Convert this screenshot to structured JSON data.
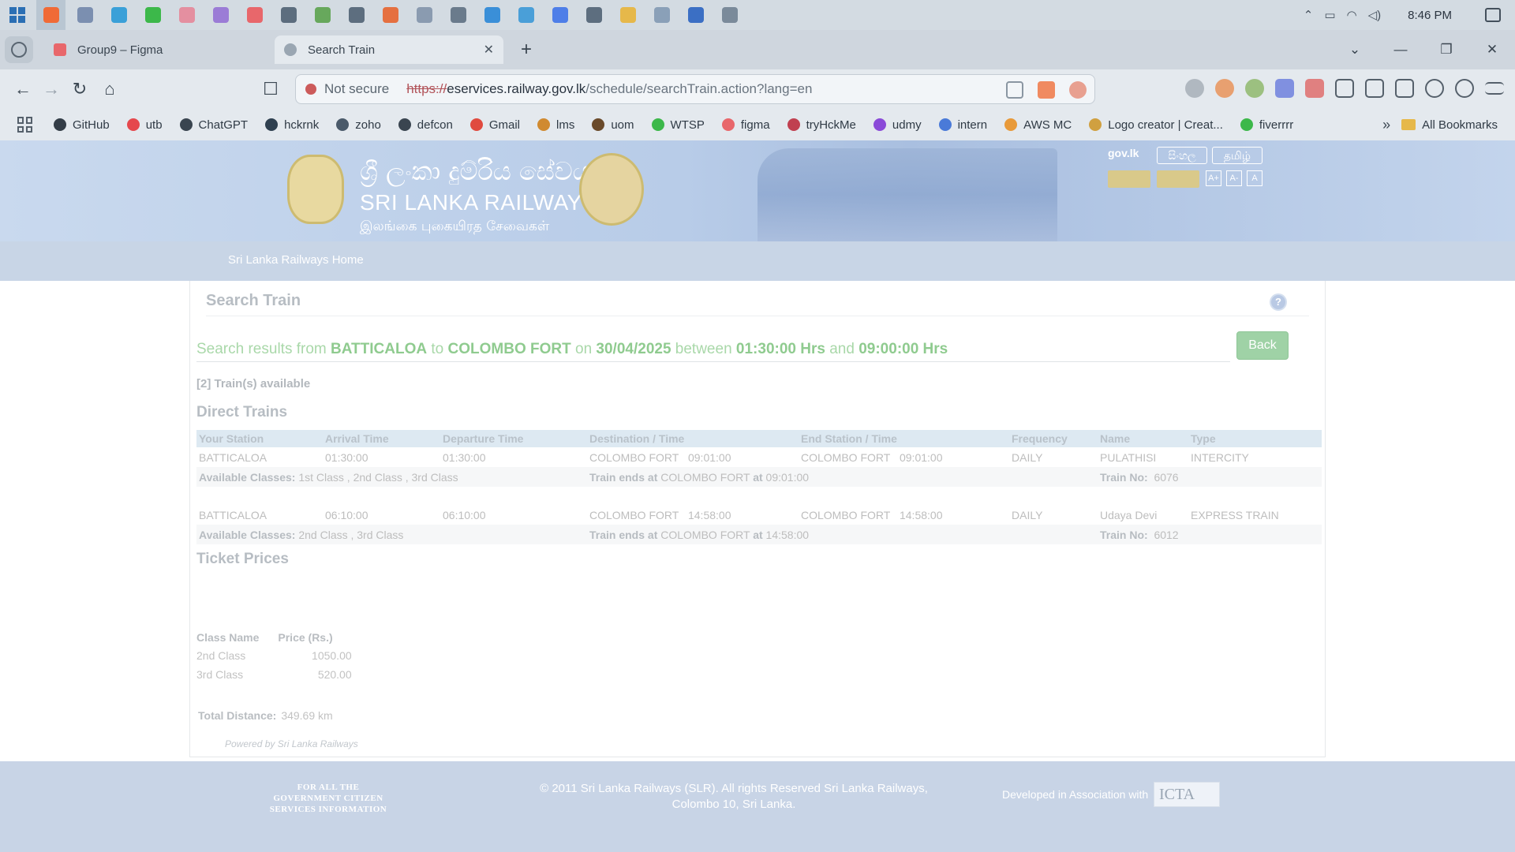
{
  "taskbar": {
    "clock": "8:46 PM",
    "apps": [
      {
        "icon": "brave-icon",
        "color": "#f06a36"
      },
      {
        "icon": "app-icon",
        "color": "#7b8fb0"
      },
      {
        "icon": "telegram-icon",
        "color": "#3aa0d8"
      },
      {
        "icon": "whatsapp-icon",
        "color": "#3cb84a"
      },
      {
        "icon": "app-icon",
        "color": "#e48fa0"
      },
      {
        "icon": "copilot-icon",
        "color": "#9b7cd6"
      },
      {
        "icon": "figma-icon",
        "color": "#e8676b"
      },
      {
        "icon": "cube-icon",
        "color": "#5c6d7e"
      },
      {
        "icon": "file-icon",
        "color": "#67a85c"
      },
      {
        "icon": "app-icon",
        "color": "#5d6e7f"
      },
      {
        "icon": "app-icon",
        "color": "#e57040"
      },
      {
        "icon": "app-icon",
        "color": "#8a9bb0"
      },
      {
        "icon": "app-icon",
        "color": "#6a7b8c"
      },
      {
        "icon": "vscode-icon",
        "color": "#3a8fd8"
      },
      {
        "icon": "app-icon",
        "color": "#4a9fd8"
      },
      {
        "icon": "zoom-icon",
        "color": "#4e7ee8"
      },
      {
        "icon": "app-icon",
        "color": "#5d6e7f"
      },
      {
        "icon": "folder-icon",
        "color": "#e6b84a"
      },
      {
        "icon": "app-icon",
        "color": "#8aa0b8"
      },
      {
        "icon": "word-icon",
        "color": "#3b6fc4"
      },
      {
        "icon": "app-icon",
        "color": "#7a8a9a"
      }
    ]
  },
  "browser": {
    "tabs": [
      {
        "title": "Group9 – Figma",
        "favicon_color": "#e8676b"
      },
      {
        "title": "Search Train",
        "favicon_color": "#9aa6b2"
      }
    ],
    "url": {
      "security_label": "Not secure",
      "scheme": "https://",
      "host": "eservices.railway.gov.lk",
      "path": "/schedule/searchTrain.action?lang=en"
    },
    "bookmarks": [
      {
        "label": "GitHub",
        "color": "#333d47"
      },
      {
        "label": "utb",
        "color": "#e5484d"
      },
      {
        "label": "ChatGPT",
        "color": "#3a4550"
      },
      {
        "label": "hckrnk",
        "color": "#2f4050"
      },
      {
        "label": "zoho",
        "color": "#4a5a6a"
      },
      {
        "label": "defcon",
        "color": "#3a4550"
      },
      {
        "label": "Gmail",
        "color": "#e04a3f"
      },
      {
        "label": "lms",
        "color": "#d08a30"
      },
      {
        "label": "uom",
        "color": "#6a4a2a"
      },
      {
        "label": "WTSP",
        "color": "#3cb84a"
      },
      {
        "label": "figma",
        "color": "#e8676b"
      },
      {
        "label": "tryHckMe",
        "color": "#c04050"
      },
      {
        "label": "udmy",
        "color": "#8a4ad8"
      },
      {
        "label": "intern",
        "color": "#4a7ad8"
      },
      {
        "label": "AWS MC",
        "color": "#e89a3a"
      },
      {
        "label": "Logo creator | Creat...",
        "color": "#d0a040"
      },
      {
        "label": "fiverrrr",
        "color": "#3cb84a"
      }
    ],
    "all_bookmarks": "All Bookmarks"
  },
  "site": {
    "brand_si": "ශ්‍රී ලංකා දුම්රිය සේවය",
    "brand_en": "SRI LANKA RAILWAYS",
    "brand_ta": "இலங்கை புகையிரத சேவைகள்",
    "gov_link": "gov.lk",
    "lang_si": "සිංහල",
    "lang_ta": "தமிழ்",
    "font_sizes": [
      "A+",
      "A-",
      "A"
    ],
    "menu_home": "Sri Lanka Railways Home"
  },
  "search": {
    "title": "Search Train",
    "help": "?",
    "results_prefix": "Search results from",
    "from": "BATTICALOA",
    "to_word": "to",
    "to": "COLOMBO FORT",
    "on_word": "on",
    "date": "30/04/2025",
    "between_word": "between",
    "start_time": "01:30:00 Hrs",
    "and_word": "and",
    "end_time": "09:00:00 Hrs",
    "back_label": "Back",
    "available": "[2] Train(s) available"
  },
  "direct_trains": {
    "heading": "Direct Trains",
    "columns": [
      "Your Station",
      "Arrival Time",
      "Departure Time",
      "Destination / Time",
      "End Station / Time",
      "Frequency",
      "Name",
      "Type"
    ],
    "classes_label": "Available Classes:",
    "ends_label": "Train ends at",
    "at_label": "at",
    "train_no_label": "Train No:",
    "trains": [
      {
        "station": "BATTICALOA",
        "arrival": "01:30:00",
        "departure": "01:30:00",
        "destination": "COLOMBO FORT",
        "destination_time": "09:01:00",
        "end_station": "COLOMBO FORT",
        "end_time": "09:01:00",
        "frequency": "DAILY",
        "name": "PULATHISI",
        "type": "INTERCITY",
        "classes": "1st Class ,  2nd Class ,  3rd Class",
        "ends_station": "COLOMBO FORT",
        "ends_time": "09:01:00",
        "train_no": "6076"
      },
      {
        "station": "BATTICALOA",
        "arrival": "06:10:00",
        "departure": "06:10:00",
        "destination": "COLOMBO FORT",
        "destination_time": "14:58:00",
        "end_station": "COLOMBO FORT",
        "end_time": "14:58:00",
        "frequency": "DAILY",
        "name": "Udaya Devi",
        "type": "EXPRESS TRAIN",
        "classes": "2nd Class ,  3rd Class",
        "ends_station": "COLOMBO FORT",
        "ends_time": "14:58:00",
        "train_no": "6012"
      }
    ]
  },
  "ticket_prices": {
    "heading": "Ticket Prices",
    "col_class": "Class Name",
    "col_price": "Price (Rs.)",
    "rows": [
      {
        "class": "2nd Class",
        "price": "1050.00"
      },
      {
        "class": "3rd Class",
        "price": "520.00"
      }
    ],
    "distance_label": "Total Distance:",
    "distance_value": "349.69 km",
    "powered": "Powered by Sri Lanka Railways"
  },
  "footer": {
    "left_line1": "FOR ALL THE",
    "left_line2": "GOVERNMENT CITIZEN",
    "left_line3": "SERVICES INFORMATION",
    "copyright_line1": "© 2011 Sri Lanka Railways (SLR). All rights Reserved Sri Lanka Railways,",
    "copyright_line2": "Colombo 10, Sri Lanka.",
    "developed": "Developed in Association with",
    "icta": "ICTA"
  }
}
